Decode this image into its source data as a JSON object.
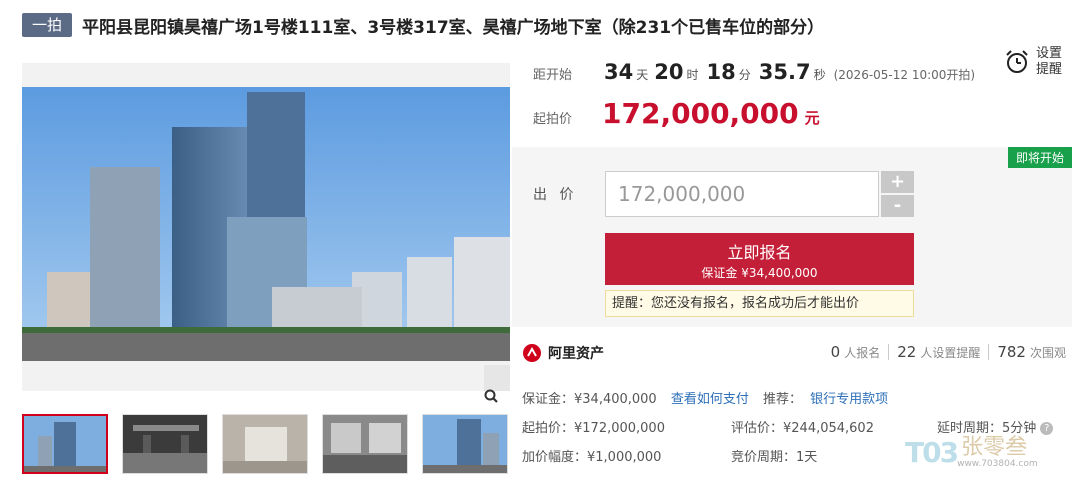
{
  "header": {
    "badge": "一拍",
    "title": "平阳县昆阳镇昊禧广场1号楼111室、3号楼317室、昊禧广场地下室（除231个已售车位的部分）"
  },
  "countdown": {
    "label": "距开始",
    "days": "34",
    "days_unit": "天",
    "hours": "20",
    "hours_unit": "时",
    "minutes": "18",
    "minutes_unit": "分",
    "seconds": "35.7",
    "seconds_unit": "秒",
    "open_time": "(2026-05-12 10:00开拍)"
  },
  "reminder": {
    "label": "设置提醒",
    "icon": "alarm-clock-icon"
  },
  "start_price": {
    "label": "起拍价",
    "value": "172,000,000",
    "unit": "元"
  },
  "bid": {
    "status_tag": "即将开始",
    "label": "出 价",
    "input_value": "172,000,000",
    "plus": "+",
    "minus": "-",
    "signup_label": "立即报名",
    "deposit_line": "保证金 ¥34,400,000",
    "tip": "提醒：您还没有报名，报名成功后才能出价"
  },
  "brand": {
    "name": "阿里资产",
    "icon": "ali-asset-logo-icon"
  },
  "stats": {
    "registered": "0",
    "registered_label": "人报名",
    "reminders": "22",
    "reminders_label": "人设置提醒",
    "views": "782",
    "views_label": "次围观"
  },
  "info": {
    "deposit": "保证金：¥34,400,000",
    "how_to_pay": "查看如何支付",
    "recommend": "推荐：",
    "bank_account": "银行专用款项",
    "start_price": "起拍价：¥172,000,000",
    "appraisal": "评估价：¥244,054,602",
    "delay": "延时周期：5分钟",
    "increment": "加价幅度：¥1,000,000",
    "cycle": "竞价周期：1天"
  },
  "watermark": {
    "logo": "T03",
    "name": "张零叁",
    "url": "www.703804.com"
  },
  "colors": {
    "accent_red": "#c41f38",
    "price_red": "#c8102e",
    "badge_blue": "#5b6a85",
    "status_green": "#19a04a",
    "link_blue": "#2d6fb8"
  }
}
